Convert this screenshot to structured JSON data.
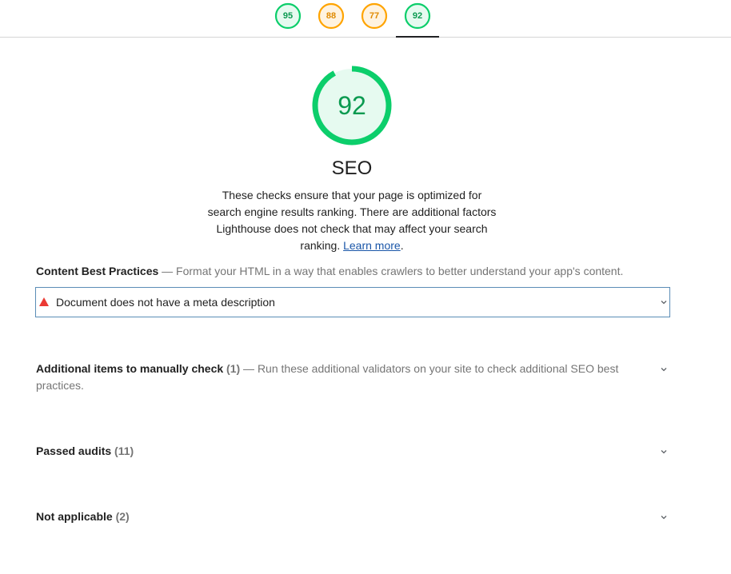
{
  "score_tabs": [
    {
      "score": "95",
      "color": "#0cce6b",
      "fill": "#e6faf0"
    },
    {
      "score": "88",
      "color": "#ffa400",
      "fill": "#fff3e0"
    },
    {
      "score": "77",
      "color": "#ffa400",
      "fill": "#fff3e0"
    },
    {
      "score": "92",
      "color": "#0cce6b",
      "fill": "#e6faf0"
    }
  ],
  "active_tab_index": 3,
  "category": {
    "score": "92",
    "score_fraction": 0.92,
    "title": "SEO",
    "description": "These checks ensure that your page is optimized for search engine results ranking. There are additional factors Lighthouse does not check that may affect your search ranking.",
    "learn_more": "Learn more",
    "learn_more_suffix": "."
  },
  "groups": {
    "content": {
      "title": "Content Best Practices",
      "description": " — Format your HTML in a way that enables crawlers to better understand your app's content."
    },
    "content_audit": {
      "text": "Document does not have a meta description",
      "status_icon": "fail-triangle-icon"
    },
    "manual": {
      "title": "Additional items to manually check",
      "count": " (1)",
      "description": "  — Run these additional validators on your site to check additional SEO best practices."
    },
    "passed": {
      "title": "Passed audits",
      "count": " (11)"
    },
    "not_applicable": {
      "title": "Not applicable",
      "count": " (2)"
    }
  },
  "colors": {
    "pass": "#0cce6b",
    "average": "#ffa400",
    "fail": "#eb3a34",
    "link": "#1a56a8"
  }
}
